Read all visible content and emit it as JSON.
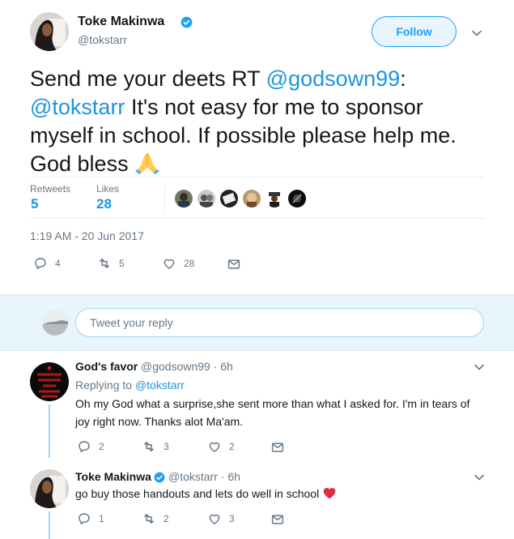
{
  "main_tweet": {
    "display_name": "Toke Makinwa",
    "handle": "@tokstarr",
    "follow_label": "Follow",
    "text_parts": {
      "p1": "Send me your deets RT ",
      "m1": "@godsown99",
      "p2": ": ",
      "m2": "@tokstarr",
      "p3": " It's not easy for me to sponsor myself in school. If possible please help me. God bless "
    },
    "retweets_label": "Retweets",
    "retweets_value": "5",
    "likes_label": "Likes",
    "likes_value": "28",
    "timestamp": "1:19 AM - 20 Jun 2017",
    "actions": {
      "replies": "4",
      "retweets": "5",
      "likes": "28"
    }
  },
  "reply_box": {
    "placeholder": "Tweet your reply"
  },
  "replies": [
    {
      "display_name": "God's favor",
      "handle_time": "@godsown99 · 6h",
      "replying_prefix": "Replying to ",
      "replying_to": "@tokstarr",
      "text": "Oh my God what a surprise,she sent more than what I asked for. I'm in tears of joy right now. Thanks alot Ma'am.",
      "actions": {
        "replies": "2",
        "retweets": "3",
        "likes": "2"
      }
    },
    {
      "display_name": "Toke Makinwa",
      "handle_time": "@tokstarr · 6h",
      "text": "go buy those handouts and lets do well in school",
      "actions": {
        "replies": "1",
        "retweets": "2",
        "likes": "3"
      }
    }
  ],
  "colors": {
    "brand_blue": "#1da1f2",
    "link_blue": "#1b95e0",
    "secondary_text": "#657786",
    "reply_bar_bg": "#e8f5fd"
  },
  "icons": [
    "verified-icon",
    "chevron-down-icon",
    "reply-icon",
    "retweet-icon",
    "like-icon",
    "message-icon",
    "folded-hands-emoji",
    "red-heart-emoji"
  ]
}
